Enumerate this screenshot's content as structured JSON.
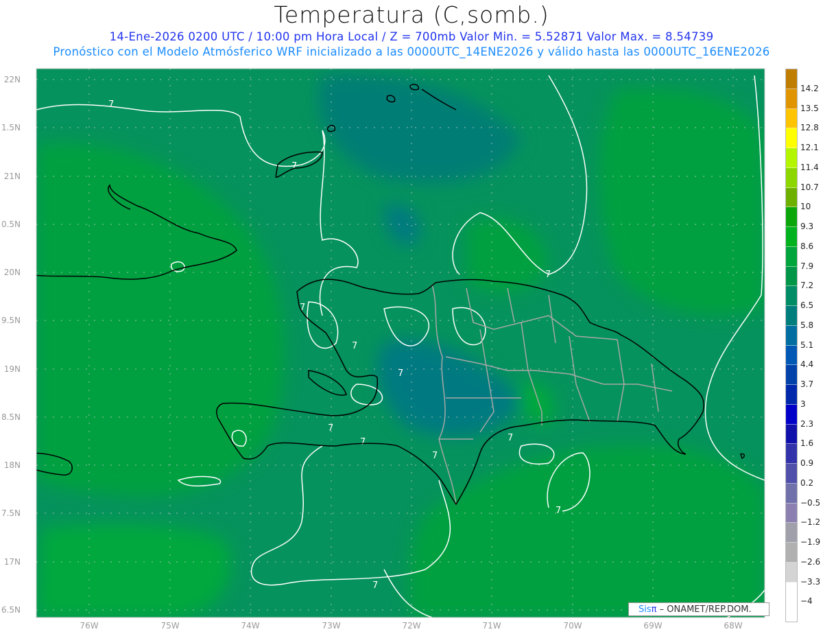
{
  "header": {
    "title": "Temperatura (C,somb.)",
    "line1": "14-Ene-2026  0200 UTC / 10:00 pm Hora Local / Z = 700mb   Valor Min. = 5.52871  Valor Max. = 8.54739",
    "line2": "Pronóstico con el Modelo Atmósferico WRF inicializado a las 0000UTC_14ENE2026 y válido hasta las  0000UTC_16ENE2026"
  },
  "axes": {
    "lat_labels": [
      "22N",
      "1.5N",
      "21N",
      "0.5N",
      "20N",
      "9.5N",
      "19N",
      "8.5N",
      "18N",
      "7.5N",
      "17N",
      "6.5N"
    ],
    "lon_labels": [
      "76W",
      "75W",
      "74W",
      "73W",
      "72W",
      "71W",
      "70W",
      "69W",
      "68W"
    ]
  },
  "contours": {
    "label": "7"
  },
  "colorbar": {
    "labels": [
      "14.2",
      "13.5",
      "12.8",
      "12.1",
      "11.4",
      "10.7",
      "10",
      "9.3",
      "8.6",
      "7.9",
      "7.2",
      "6.5",
      "5.8",
      "5.1",
      "4.4",
      "3.7",
      "3",
      "2.3",
      "1.6",
      "0.9",
      "0.2",
      "−0.5",
      "−1.2",
      "−1.9",
      "−2.6",
      "−3.3",
      "−4"
    ],
    "colors": [
      "#c07e00",
      "#e09400",
      "#ffc400",
      "#ffff00",
      "#b4f500",
      "#8cd700",
      "#6db000",
      "#0aa60a",
      "#00b21e",
      "#00a53c",
      "#009648",
      "#008c64",
      "#007d7d",
      "#006ea0",
      "#0058b4",
      "#0041aa",
      "#0028aa",
      "#0000c8",
      "#1010aa",
      "#3232aa",
      "#5050aa",
      "#7070aa",
      "#8c80b0",
      "#a0a0aa",
      "#b0b0b0",
      "#d4d4d4",
      "#ffffff"
    ],
    "bottom_color": "#ffffff"
  },
  "logo": {
    "sis": "Sis",
    "pi": "π",
    "text": "– ONAMET/REP.DOM."
  },
  "colors": {
    "field_base": "#05925c",
    "field_warm": "#00a040",
    "coast": "#000000",
    "provinces": "#a0a0a0",
    "contour": "#ffffff"
  }
}
